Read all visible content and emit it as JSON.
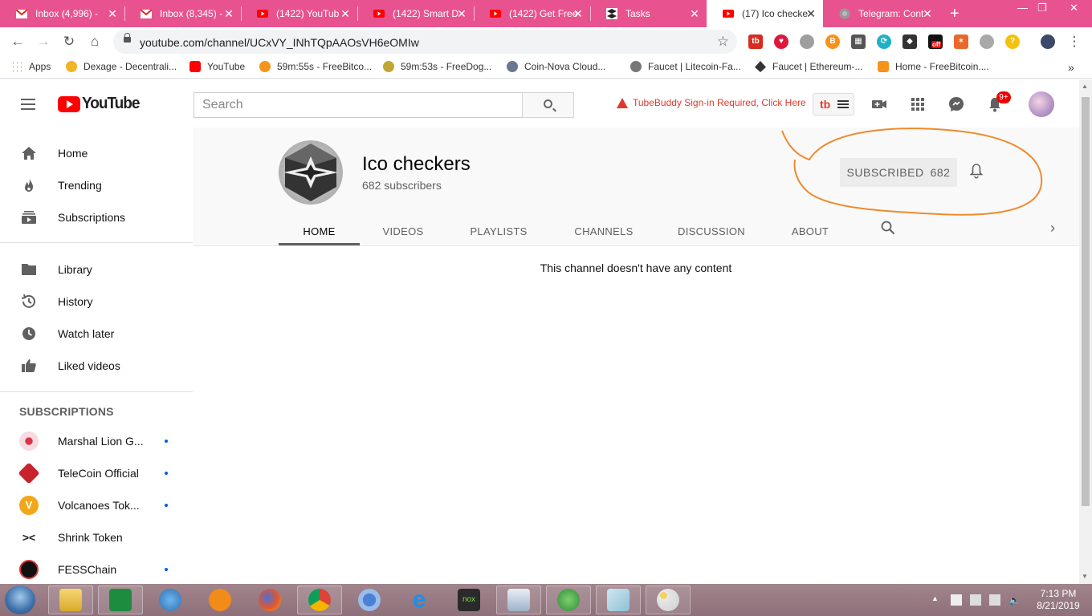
{
  "browser": {
    "tabs": [
      {
        "label": "Inbox (4,996) - ",
        "icon": "gmail-icon"
      },
      {
        "label": "Inbox (8,345) - ",
        "icon": "gmail-icon"
      },
      {
        "label": "(1422) YouTub",
        "icon": "youtube-icon"
      },
      {
        "label": "(1422) Smart D",
        "icon": "youtube-icon"
      },
      {
        "label": "(1422) Get Free",
        "icon": "youtube-icon"
      },
      {
        "label": "Tasks",
        "icon": "tasks-icon"
      },
      {
        "label": "(17) Ico checke",
        "icon": "youtube-icon"
      },
      {
        "label": "Telegram: Cont",
        "icon": "globe-icon"
      }
    ],
    "url": "youtube.com/channel/UCxVY_INhTQpAAOsVH6eOMIw",
    "bookmarks": [
      {
        "label": "Apps"
      },
      {
        "label": "Dexage - Decentrali..."
      },
      {
        "label": "YouTube"
      },
      {
        "label": "59m:55s - FreeBitco..."
      },
      {
        "label": "59m:53s - FreeDog..."
      },
      {
        "label": "Coin-Nova Cloud..."
      },
      {
        "label": "Faucet | Litecoin-Fa..."
      },
      {
        "label": "Faucet | Ethereum-..."
      },
      {
        "label": "Home - FreeBitcoin...."
      }
    ],
    "extensions": {
      "off_badge": "off"
    }
  },
  "youtube": {
    "logo_text": "YouTube",
    "search_placeholder": "Search",
    "tubebuddy_warning": "TubeBuddy Sign-in Required, Click Here",
    "notification_badge": "9+"
  },
  "sidebar": {
    "main_items": [
      {
        "label": "Home",
        "icon": "home-icon"
      },
      {
        "label": "Trending",
        "icon": "flame-icon"
      },
      {
        "label": "Subscriptions",
        "icon": "subscriptions-icon"
      }
    ],
    "library_items": [
      {
        "label": "Library",
        "icon": "folder-icon"
      },
      {
        "label": "History",
        "icon": "history-icon"
      },
      {
        "label": "Watch later",
        "icon": "clock-icon"
      },
      {
        "label": "Liked videos",
        "icon": "thumbs-up-icon"
      }
    ],
    "subscriptions_header": "SUBSCRIPTIONS",
    "subscriptions": [
      {
        "label": "Marshal Lion G...",
        "color": "#f3d0d8",
        "new": true
      },
      {
        "label": "TeleCoin Official",
        "color": "#c8232c",
        "new": true
      },
      {
        "label": "Volcanoes Tok...",
        "color": "#f2a71b",
        "new": true
      },
      {
        "label": "Shrink Token",
        "color": "#ffffff",
        "new": false
      },
      {
        "label": "FESSChain",
        "color": "#111111",
        "new": true
      }
    ]
  },
  "channel": {
    "name": "Ico checkers",
    "subscribers": "682 subscribers",
    "subscribe_label": "SUBSCRIBED",
    "subscribe_count": "682",
    "tabs": [
      "HOME",
      "VIDEOS",
      "PLAYLISTS",
      "CHANNELS",
      "DISCUSSION",
      "ABOUT"
    ],
    "active_tab": "HOME",
    "empty_message": "This channel doesn't have any content"
  },
  "taskbar": {
    "apps": [
      "file-explorer",
      "excel",
      "network-globe",
      "avast",
      "firefox",
      "chrome",
      "chrome-alt",
      "internet-explorer",
      "nox",
      "app-window",
      "globe-arrow",
      "notes",
      "paint"
    ],
    "clock_time": "7:13 PM",
    "clock_date": "8/21/2019"
  },
  "colors": {
    "tab_strip": "#e8538f",
    "youtube_red": "#ff0000",
    "annotation_circle": "#f08a2c",
    "taskbar": "#987a84"
  }
}
